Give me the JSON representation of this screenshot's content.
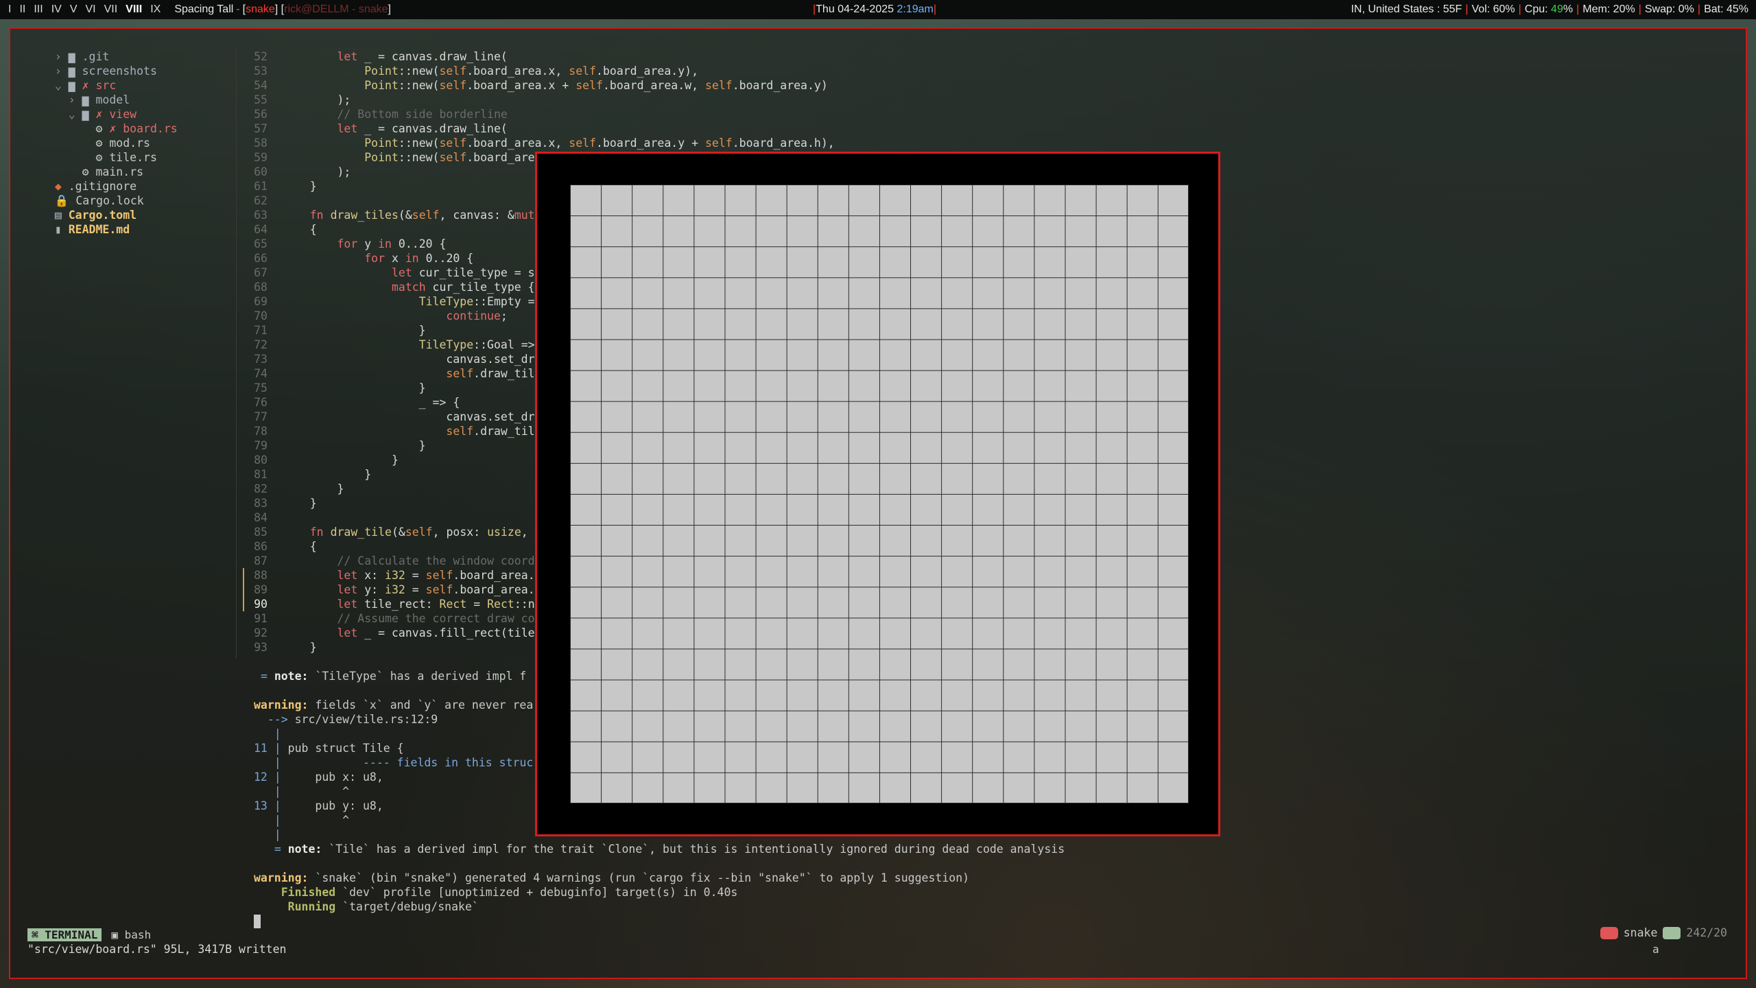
{
  "topbar": {
    "workspaces": [
      "I",
      "II",
      "III",
      "IV",
      "V",
      "VI",
      "VII",
      "VIII",
      "IX"
    ],
    "active_workspace": "VIII",
    "layout": "Spacing Tall",
    "window_prefix": "[",
    "window_app": "snake",
    "window_mid": "] [",
    "window_title": "rick@DELLM - snake",
    "window_suffix": "]",
    "clock_date": "Thu 04-24-2025",
    "clock_time": "2:19am",
    "weather": "IN, United States : 55F",
    "vol": "Vol: 60%",
    "cpu_label": "Cpu: ",
    "cpu_value": "49",
    "cpu_unit": "%",
    "mem": "Mem: 20%",
    "swap": "Swap: 0%",
    "bat": "Bat: 45%"
  },
  "tree": {
    "items": [
      {
        "prefix": "  › ",
        "icon": "folder-icon",
        "label": ".git"
      },
      {
        "prefix": "  › ",
        "icon": "folder-icon",
        "label": "screenshots"
      },
      {
        "prefix": "  ⌄ ",
        "icon": "folder-open-icon",
        "label": "src",
        "mark": "✗"
      },
      {
        "prefix": "    › ",
        "icon": "folder-icon",
        "label": "model"
      },
      {
        "prefix": "    ⌄ ",
        "icon": "folder-open-icon",
        "label": "view",
        "mark": "✗"
      },
      {
        "prefix": "        ",
        "icon": "rust-icon",
        "label": "board.rs",
        "mark": "✗"
      },
      {
        "prefix": "        ",
        "icon": "rust-icon",
        "label": "mod.rs"
      },
      {
        "prefix": "        ",
        "icon": "rust-icon",
        "label": "tile.rs"
      },
      {
        "prefix": "      ",
        "icon": "rust-icon",
        "label": "main.rs"
      },
      {
        "prefix": "  ",
        "icon": "git-icon",
        "label": ".gitignore"
      },
      {
        "prefix": "  ",
        "icon": "lock-icon",
        "label": "Cargo.lock"
      },
      {
        "prefix": "  ",
        "icon": "toml-icon",
        "label": "Cargo.toml"
      },
      {
        "prefix": "  ",
        "icon": "readme-icon",
        "label": "README.md"
      }
    ]
  },
  "code": {
    "lines": [
      {
        "n": "52",
        "t": "        let _ = canvas.draw_line("
      },
      {
        "n": "53",
        "t": "            Point::new(self.board_area.x, self.board_area.y),"
      },
      {
        "n": "54",
        "t": "            Point::new(self.board_area.x + self.board_area.w, self.board_area.y)"
      },
      {
        "n": "55",
        "t": "        );"
      },
      {
        "n": "56",
        "t": "        // Bottom side borderline"
      },
      {
        "n": "57",
        "t": "        let _ = canvas.draw_line("
      },
      {
        "n": "58",
        "t": "            Point::new(self.board_area.x, self.board_area.y + self.board_area.h),"
      },
      {
        "n": "59",
        "t": "            Point::new(self.board_area"
      },
      {
        "n": "60",
        "t": "        );"
      },
      {
        "n": "61",
        "t": "    }"
      },
      {
        "n": "62",
        "t": ""
      },
      {
        "n": "63",
        "t": "    fn draw_tiles(&self, canvas: &mut"
      },
      {
        "n": "64",
        "t": "    {"
      },
      {
        "n": "65",
        "t": "        for y in 0..20 {"
      },
      {
        "n": "66",
        "t": "            for x in 0..20 {"
      },
      {
        "n": "67",
        "t": "                let cur_tile_type = se"
      },
      {
        "n": "68",
        "t": "                match cur_tile_type {"
      },
      {
        "n": "69",
        "t": "                    TileType::Empty =>"
      },
      {
        "n": "70",
        "t": "                        continue;"
      },
      {
        "n": "71",
        "t": "                    }"
      },
      {
        "n": "72",
        "t": "                    TileType::Goal =>"
      },
      {
        "n": "73",
        "t": "                        canvas.set_dra"
      },
      {
        "n": "74",
        "t": "                        self.draw_tile"
      },
      {
        "n": "75",
        "t": "                    }"
      },
      {
        "n": "76",
        "t": "                    _ => {"
      },
      {
        "n": "77",
        "t": "                        canvas.set_dra"
      },
      {
        "n": "78",
        "t": "                        self.draw_tile"
      },
      {
        "n": "79",
        "t": "                    }"
      },
      {
        "n": "80",
        "t": "                }"
      },
      {
        "n": "81",
        "t": "            }"
      },
      {
        "n": "82",
        "t": "        }"
      },
      {
        "n": "83",
        "t": "    }"
      },
      {
        "n": "84",
        "t": ""
      },
      {
        "n": "85",
        "t": "    fn draw_tile(&self, posx: usize, p"
      },
      {
        "n": "86",
        "t": "    {"
      },
      {
        "n": "87",
        "t": "        // Calculate the window coordi"
      },
      {
        "n": "88",
        "t": "        let x: i32 = self.board_area.x"
      },
      {
        "n": "89",
        "t": "        let y: i32 = self.board_area.y"
      },
      {
        "n": "90",
        "t": "        let tile_rect: Rect = Rect::ne"
      },
      {
        "n": "91",
        "t": "        // Assume the correct draw col"
      },
      {
        "n": "92",
        "t": "        let _ = canvas.fill_rect(tile_"
      },
      {
        "n": "93",
        "t": "    }"
      }
    ],
    "current_line": "90"
  },
  "output": {
    "lines": [
      " = note: `TileType` has a derived impl f",
      "",
      "warning: fields `x` and `y` are never rea",
      "  --> src/view/tile.rs:12:9",
      "   |",
      "11 | pub struct Tile {",
      "   |            ---- fields in this struc",
      "12 |     pub x: u8,",
      "   |         ^",
      "13 |     pub y: u8,",
      "   |         ^",
      "   |",
      "   = note: `Tile` has a derived impl for the trait `Clone`, but this is intentionally ignored during dead code analysis",
      "",
      "warning: `snake` (bin \"snake\") generated 4 warnings (run `cargo fix --bin \"snake\"` to apply 1 suggestion)",
      "    Finished `dev` profile [unoptimized + debuginfo] target(s) in 0.40s",
      "     Running `target/debug/snake`"
    ]
  },
  "statusline": {
    "terminal_tab": "TERMINAL",
    "bash_tab": "bash",
    "message": "\"src/view/board.rs\" 95L, 3417B written",
    "project": "snake",
    "position": "242/20",
    "mode_char": "a"
  },
  "game": {
    "grid_rows": 20,
    "grid_cols": 20,
    "tile_color": "#c8c8c8",
    "border_color": "#d91c1c"
  },
  "colors": {
    "accent_red": "#c81a1a",
    "terminal_tab": "#9fbf9f"
  }
}
